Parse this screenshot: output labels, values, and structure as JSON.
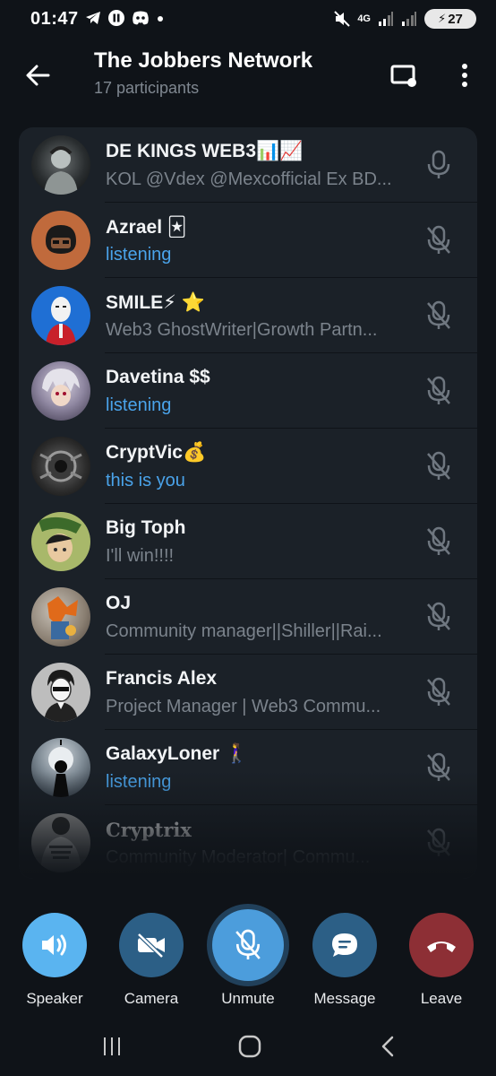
{
  "status_bar": {
    "time": "01:47",
    "network": "4G",
    "battery": "27"
  },
  "header": {
    "title": "The Jobbers Network",
    "subtitle": "17 participants"
  },
  "participants": [
    {
      "name": "DE KINGS WEB3📊📈",
      "status": "KOL @Vdex @Mexcofficial Ex BD...",
      "status_color": "grey",
      "mic": "mic-on"
    },
    {
      "name": "Azrael 🃏",
      "status": "listening",
      "status_color": "blue",
      "mic": "mic-off"
    },
    {
      "name": "SMILE⚡ ⭐",
      "status": "Web3 GhostWriter|Growth Partn...",
      "status_color": "grey",
      "mic": "mic-off"
    },
    {
      "name": "Davetina $$",
      "status": "listening",
      "status_color": "blue",
      "mic": "mic-off"
    },
    {
      "name": "CryptVic💰",
      "status": "this is you",
      "status_color": "blue",
      "mic": "mic-off"
    },
    {
      "name": "Big Toph",
      "status": "I'll win!!!!",
      "status_color": "grey",
      "mic": "mic-off"
    },
    {
      "name": "OJ",
      "status": "Community manager||Shiller||Rai...",
      "status_color": "grey",
      "mic": "mic-off"
    },
    {
      "name": "Francis Alex",
      "status": "Project Manager | Web3 Commu...",
      "status_color": "grey",
      "mic": "mic-off"
    },
    {
      "name": "GalaxyLoner 🚶‍♀️",
      "status": "listening",
      "status_color": "blue",
      "mic": "mic-off"
    },
    {
      "name": "𝐂𝐫𝐲𝐩𝐭𝐫𝐢𝐱",
      "status": "Community Moderator| Commu...",
      "status_color": "grey",
      "mic": "mic-off"
    }
  ],
  "controls": {
    "speaker": "Speaker",
    "camera": "Camera",
    "unmute": "Unmute",
    "message": "Message",
    "leave": "Leave"
  },
  "colors": {
    "background": "#0f1318",
    "list_bg": "#1b2128",
    "accent_blue": "#4aa3ea",
    "speaker_btn": "#5ab4f0",
    "camera_btn": "#2c5f86",
    "unmute_btn": "#4c9ddc",
    "message_btn": "#2c5f86",
    "leave_btn": "#8d2f35"
  }
}
